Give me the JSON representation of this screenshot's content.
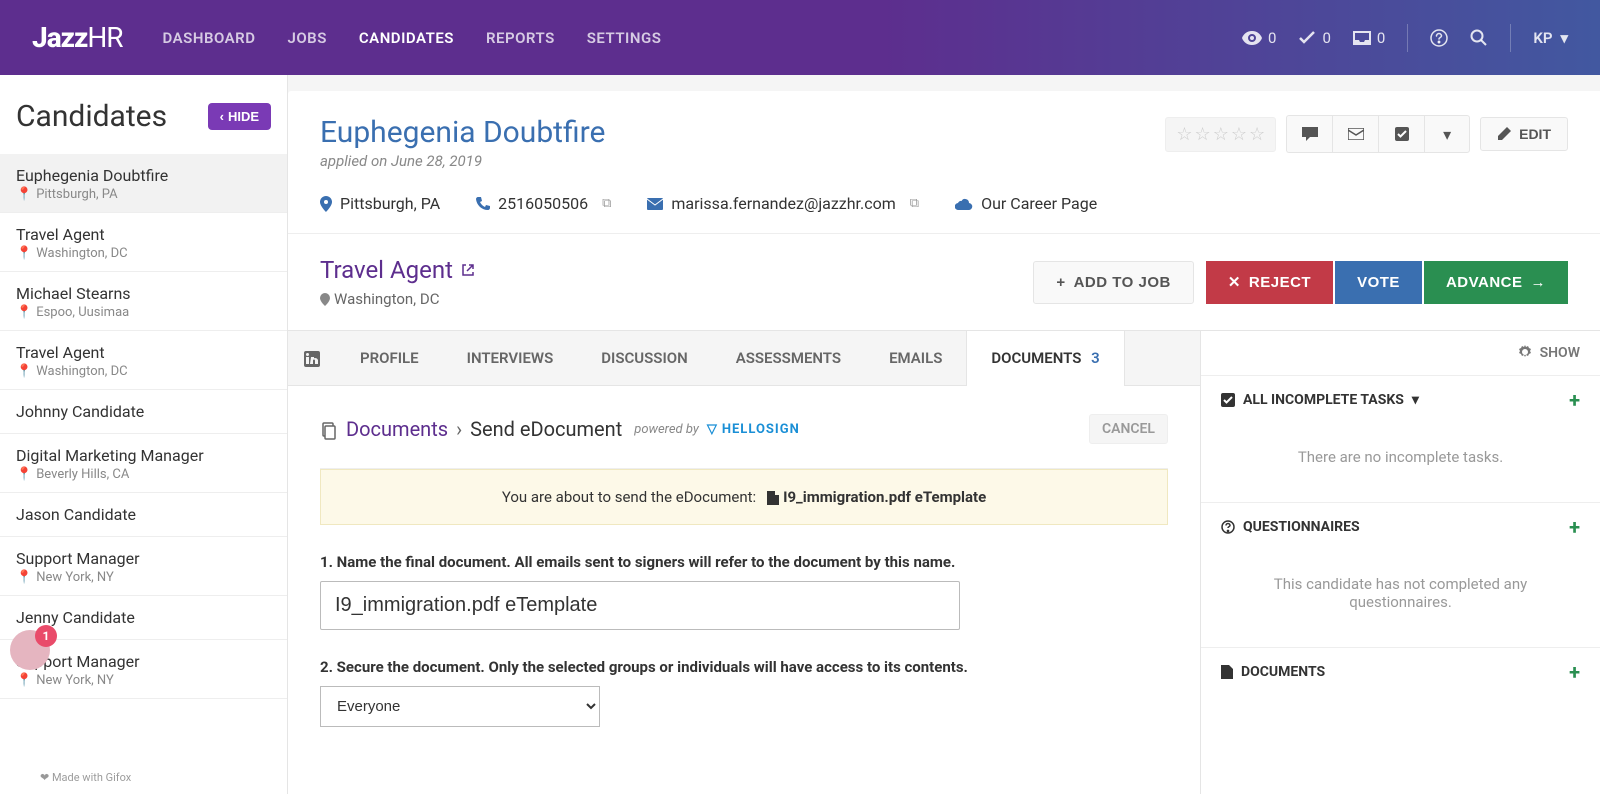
{
  "topbar": {
    "logo_main": "Jazz",
    "logo_suffix": "HR",
    "nav": [
      "DASHBOARD",
      "JOBS",
      "CANDIDATES",
      "REPORTS",
      "SETTINGS"
    ],
    "nav_active": 2,
    "views": "0",
    "checks": "0",
    "inbox": "0",
    "user": "KP"
  },
  "sidebar": {
    "title": "Candidates",
    "hide_label": "HIDE",
    "items": [
      {
        "name": "Euphegenia Doubtfire",
        "loc": "Pittsburgh, PA"
      },
      {
        "name": "Travel Agent",
        "loc": "Washington, DC"
      },
      {
        "name": "Michael Stearns",
        "loc": "Espoo, Uusimaa"
      },
      {
        "name": "Travel Agent",
        "loc": "Washington, DC"
      },
      {
        "name": "Johnny Candidate",
        "loc": ""
      },
      {
        "name": "Digital Marketing Manager",
        "loc": "Beverly Hills, CA"
      },
      {
        "name": "Jason Candidate",
        "loc": ""
      },
      {
        "name": "Support Manager",
        "loc": "New York, NY"
      },
      {
        "name": "Jenny Candidate",
        "loc": ""
      },
      {
        "name": "Support Manager",
        "loc": "New York, NY"
      }
    ]
  },
  "candidate": {
    "name": "Euphegenia Doubtfire",
    "applied": "applied on June 28, 2019",
    "location": "Pittsburgh, PA",
    "phone": "2516050506",
    "email": "marissa.fernandez@jazzhr.com",
    "source": "Our Career Page",
    "edit_label": "EDIT"
  },
  "job": {
    "title": "Travel Agent",
    "loc": "Washington, DC",
    "add_label": "ADD TO JOB",
    "reject_label": "REJECT",
    "vote_label": "VOTE",
    "advance_label": "ADVANCE"
  },
  "tabs": {
    "profile": "PROFILE",
    "interviews": "INTERVIEWS",
    "discussion": "DISCUSSION",
    "assessments": "ASSESSMENTS",
    "emails": "EMAILS",
    "documents": "DOCUMENTS",
    "documents_count": "3"
  },
  "docs": {
    "bc_root": "Documents",
    "bc_current": "Send eDocument",
    "powered": "powered by",
    "hellosign": "HELLOSIGN",
    "cancel": "CANCEL",
    "info_prefix": "You are about to send the eDocument:",
    "info_file": "I9_immigration.pdf eTemplate",
    "step1_label": "1. Name the final document. All emails sent to signers will refer to the document by this name.",
    "step1_value": "I9_immigration.pdf eTemplate",
    "step2_label": "2. Secure the document. Only the selected groups or individuals will have access to its contents.",
    "step2_value": "Everyone"
  },
  "right": {
    "show": "SHOW",
    "tasks_title": "ALL INCOMPLETE TASKS",
    "tasks_empty": "There are no incomplete tasks.",
    "quest_title": "QUESTIONNAIRES",
    "quest_empty": "This candidate has not completed any questionnaires.",
    "docs_title": "DOCUMENTS"
  },
  "footer_badge": "1",
  "gifox": "Made with Gifox"
}
